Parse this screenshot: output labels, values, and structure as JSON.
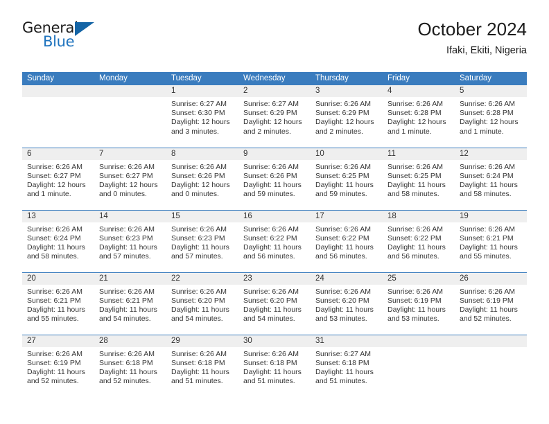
{
  "brand": {
    "word_one": "General",
    "word_two": "Blue",
    "triangle_icon": "triangle-icon",
    "accent_color": "#1e73be"
  },
  "header": {
    "title": "October 2024",
    "subtitle": "Ifaki, Ekiti, Nigeria"
  },
  "theme": {
    "header_blue": "#3a7cbe",
    "date_band_gray": "#efefef",
    "text": "#333333"
  },
  "weekdays": [
    "Sunday",
    "Monday",
    "Tuesday",
    "Wednesday",
    "Thursday",
    "Friday",
    "Saturday"
  ],
  "weeks": [
    [
      {
        "date": "",
        "lines": []
      },
      {
        "date": "",
        "lines": []
      },
      {
        "date": "1",
        "lines": [
          "Sunrise: 6:27 AM",
          "Sunset: 6:30 PM",
          "Daylight: 12 hours",
          "and 3 minutes."
        ]
      },
      {
        "date": "2",
        "lines": [
          "Sunrise: 6:27 AM",
          "Sunset: 6:29 PM",
          "Daylight: 12 hours",
          "and 2 minutes."
        ]
      },
      {
        "date": "3",
        "lines": [
          "Sunrise: 6:26 AM",
          "Sunset: 6:29 PM",
          "Daylight: 12 hours",
          "and 2 minutes."
        ]
      },
      {
        "date": "4",
        "lines": [
          "Sunrise: 6:26 AM",
          "Sunset: 6:28 PM",
          "Daylight: 12 hours",
          "and 1 minute."
        ]
      },
      {
        "date": "5",
        "lines": [
          "Sunrise: 6:26 AM",
          "Sunset: 6:28 PM",
          "Daylight: 12 hours",
          "and 1 minute."
        ]
      }
    ],
    [
      {
        "date": "6",
        "lines": [
          "Sunrise: 6:26 AM",
          "Sunset: 6:27 PM",
          "Daylight: 12 hours",
          "and 1 minute."
        ]
      },
      {
        "date": "7",
        "lines": [
          "Sunrise: 6:26 AM",
          "Sunset: 6:27 PM",
          "Daylight: 12 hours",
          "and 0 minutes."
        ]
      },
      {
        "date": "8",
        "lines": [
          "Sunrise: 6:26 AM",
          "Sunset: 6:26 PM",
          "Daylight: 12 hours",
          "and 0 minutes."
        ]
      },
      {
        "date": "9",
        "lines": [
          "Sunrise: 6:26 AM",
          "Sunset: 6:26 PM",
          "Daylight: 11 hours",
          "and 59 minutes."
        ]
      },
      {
        "date": "10",
        "lines": [
          "Sunrise: 6:26 AM",
          "Sunset: 6:25 PM",
          "Daylight: 11 hours",
          "and 59 minutes."
        ]
      },
      {
        "date": "11",
        "lines": [
          "Sunrise: 6:26 AM",
          "Sunset: 6:25 PM",
          "Daylight: 11 hours",
          "and 58 minutes."
        ]
      },
      {
        "date": "12",
        "lines": [
          "Sunrise: 6:26 AM",
          "Sunset: 6:24 PM",
          "Daylight: 11 hours",
          "and 58 minutes."
        ]
      }
    ],
    [
      {
        "date": "13",
        "lines": [
          "Sunrise: 6:26 AM",
          "Sunset: 6:24 PM",
          "Daylight: 11 hours",
          "and 58 minutes."
        ]
      },
      {
        "date": "14",
        "lines": [
          "Sunrise: 6:26 AM",
          "Sunset: 6:23 PM",
          "Daylight: 11 hours",
          "and 57 minutes."
        ]
      },
      {
        "date": "15",
        "lines": [
          "Sunrise: 6:26 AM",
          "Sunset: 6:23 PM",
          "Daylight: 11 hours",
          "and 57 minutes."
        ]
      },
      {
        "date": "16",
        "lines": [
          "Sunrise: 6:26 AM",
          "Sunset: 6:22 PM",
          "Daylight: 11 hours",
          "and 56 minutes."
        ]
      },
      {
        "date": "17",
        "lines": [
          "Sunrise: 6:26 AM",
          "Sunset: 6:22 PM",
          "Daylight: 11 hours",
          "and 56 minutes."
        ]
      },
      {
        "date": "18",
        "lines": [
          "Sunrise: 6:26 AM",
          "Sunset: 6:22 PM",
          "Daylight: 11 hours",
          "and 56 minutes."
        ]
      },
      {
        "date": "19",
        "lines": [
          "Sunrise: 6:26 AM",
          "Sunset: 6:21 PM",
          "Daylight: 11 hours",
          "and 55 minutes."
        ]
      }
    ],
    [
      {
        "date": "20",
        "lines": [
          "Sunrise: 6:26 AM",
          "Sunset: 6:21 PM",
          "Daylight: 11 hours",
          "and 55 minutes."
        ]
      },
      {
        "date": "21",
        "lines": [
          "Sunrise: 6:26 AM",
          "Sunset: 6:21 PM",
          "Daylight: 11 hours",
          "and 54 minutes."
        ]
      },
      {
        "date": "22",
        "lines": [
          "Sunrise: 6:26 AM",
          "Sunset: 6:20 PM",
          "Daylight: 11 hours",
          "and 54 minutes."
        ]
      },
      {
        "date": "23",
        "lines": [
          "Sunrise: 6:26 AM",
          "Sunset: 6:20 PM",
          "Daylight: 11 hours",
          "and 54 minutes."
        ]
      },
      {
        "date": "24",
        "lines": [
          "Sunrise: 6:26 AM",
          "Sunset: 6:20 PM",
          "Daylight: 11 hours",
          "and 53 minutes."
        ]
      },
      {
        "date": "25",
        "lines": [
          "Sunrise: 6:26 AM",
          "Sunset: 6:19 PM",
          "Daylight: 11 hours",
          "and 53 minutes."
        ]
      },
      {
        "date": "26",
        "lines": [
          "Sunrise: 6:26 AM",
          "Sunset: 6:19 PM",
          "Daylight: 11 hours",
          "and 52 minutes."
        ]
      }
    ],
    [
      {
        "date": "27",
        "lines": [
          "Sunrise: 6:26 AM",
          "Sunset: 6:19 PM",
          "Daylight: 11 hours",
          "and 52 minutes."
        ]
      },
      {
        "date": "28",
        "lines": [
          "Sunrise: 6:26 AM",
          "Sunset: 6:18 PM",
          "Daylight: 11 hours",
          "and 52 minutes."
        ]
      },
      {
        "date": "29",
        "lines": [
          "Sunrise: 6:26 AM",
          "Sunset: 6:18 PM",
          "Daylight: 11 hours",
          "and 51 minutes."
        ]
      },
      {
        "date": "30",
        "lines": [
          "Sunrise: 6:26 AM",
          "Sunset: 6:18 PM",
          "Daylight: 11 hours",
          "and 51 minutes."
        ]
      },
      {
        "date": "31",
        "lines": [
          "Sunrise: 6:27 AM",
          "Sunset: 6:18 PM",
          "Daylight: 11 hours",
          "and 51 minutes."
        ]
      },
      {
        "date": "",
        "lines": []
      },
      {
        "date": "",
        "lines": []
      }
    ]
  ]
}
